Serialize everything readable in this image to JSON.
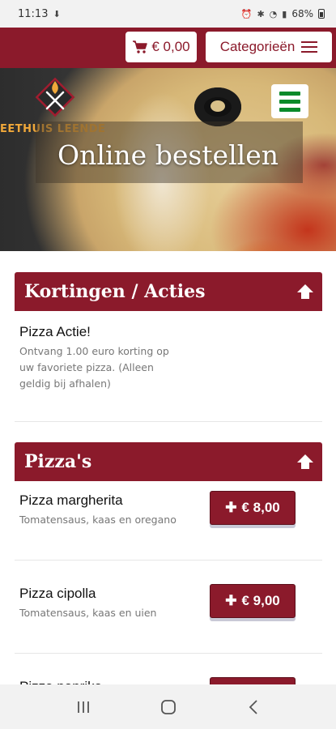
{
  "status_bar": {
    "time": "11:13",
    "battery": "68%",
    "icons": [
      "download-icon",
      "alarm-icon",
      "bluetooth-icon",
      "wifi-icon",
      "signal-icon",
      "battery-icon"
    ]
  },
  "header": {
    "cart_label": "€ 0,00",
    "categories_label": "Categorieën"
  },
  "hero": {
    "logo_text": "EETHUIS LEENDE",
    "title": "Online bestellen"
  },
  "sections": [
    {
      "title": "Kortingen / Acties",
      "items": [
        {
          "name": "Pizza Actie!",
          "description": "Ontvang 1.00 euro korting op uw favoriete pizza. (Alleen geldig bij afhalen)"
        }
      ]
    },
    {
      "title": "Pizza's",
      "items": [
        {
          "name": "Pizza margherita",
          "description": "Tomatensaus, kaas en oregano",
          "price": "€ 8,00"
        },
        {
          "name": "Pizza cipolla",
          "description": "Tomatensaus, kaas en uien",
          "price": "€ 9,00"
        },
        {
          "name": "Pizza paprika",
          "description": "",
          "price": ""
        }
      ]
    }
  ],
  "colors": {
    "brand": "#8b1a2b",
    "menu_green": "#0a8a2a",
    "logo_orange": "#f0a83a"
  },
  "nav_bar": {
    "icons": [
      "recent-apps-icon",
      "home-icon",
      "back-icon"
    ]
  }
}
